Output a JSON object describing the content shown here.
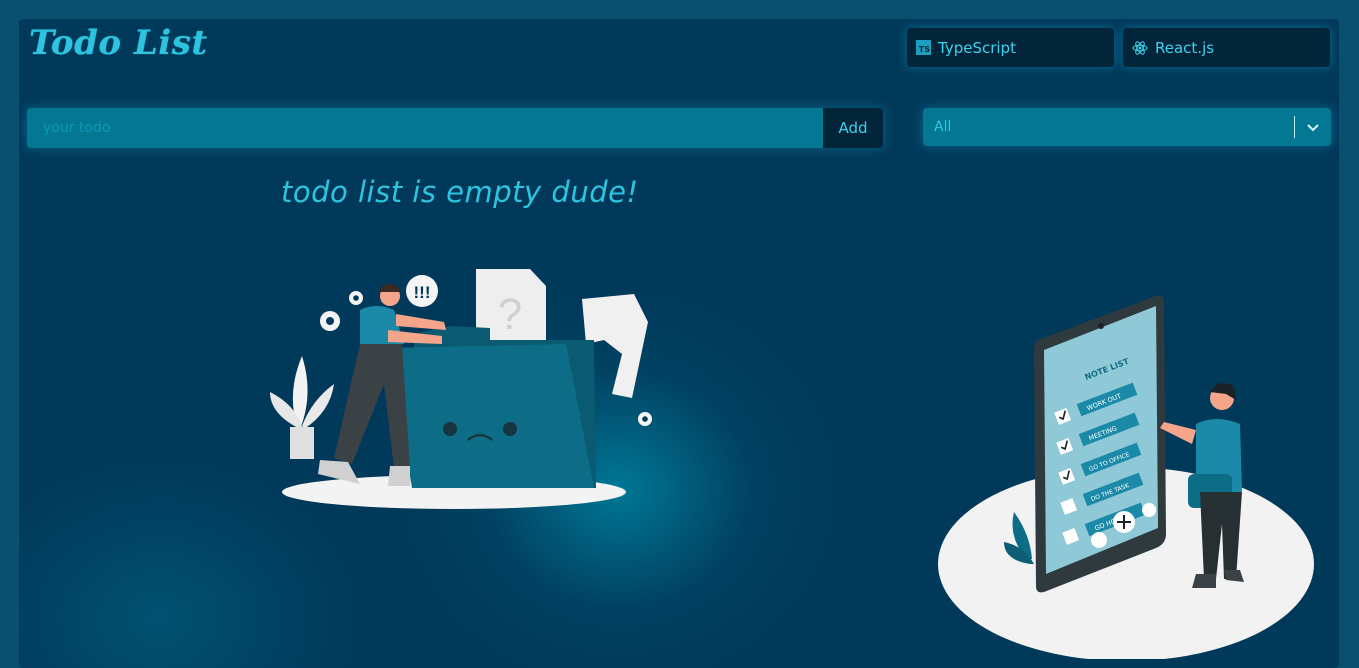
{
  "app": {
    "title": "Todo List"
  },
  "header": {
    "tech_buttons": [
      {
        "label": "TypeScript",
        "icon": "typescript-icon",
        "icon_text": "TS"
      },
      {
        "label": "React.js",
        "icon": "react-icon"
      }
    ]
  },
  "todo_form": {
    "input_value": "",
    "input_placeholder": "your todo",
    "add_label": "Add"
  },
  "filter": {
    "selected": "All",
    "icon": "chevron-down-icon"
  },
  "empty_state": {
    "message": "todo list is empty dude!",
    "alert_text": "!!!",
    "question_mark": "?"
  },
  "phone_illustration": {
    "heading": "NOTE LIST",
    "items": [
      "WORK OUT",
      "MEETING",
      "GO TO OFFICE",
      "DO THE TASK",
      "GO HOME"
    ],
    "checked": [
      true,
      true,
      true,
      false,
      false
    ]
  },
  "colors": {
    "background": "#01395a",
    "accent": "#2ec4e0",
    "input_bg": "#047793",
    "button_bg": "#02253a",
    "illustration_teal": "#0e6d86"
  }
}
